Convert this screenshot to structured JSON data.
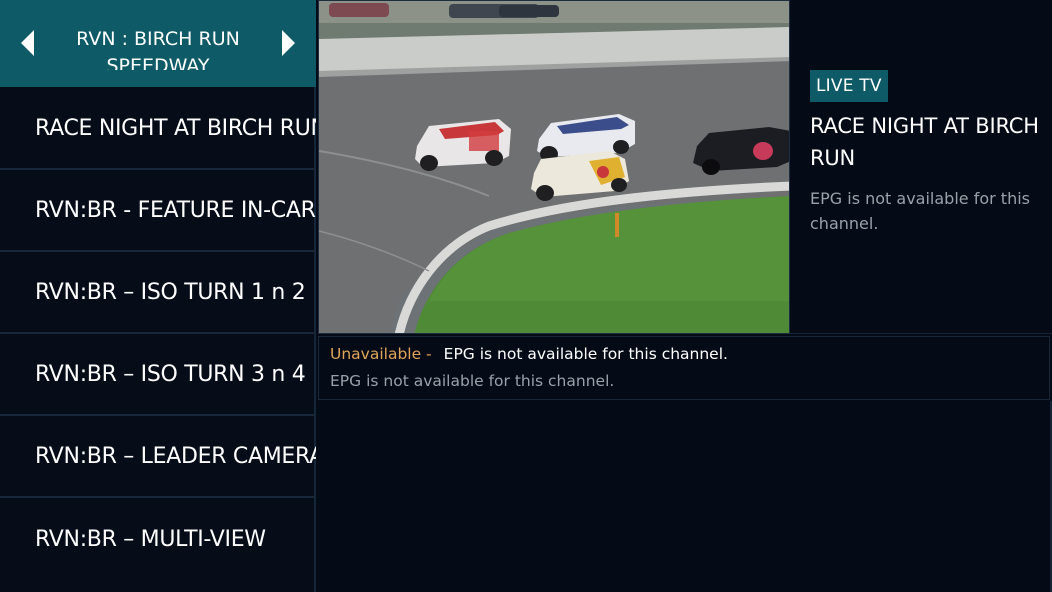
{
  "category": {
    "title": "RVN : BIRCH RUN SPEEDWAY"
  },
  "channels": [
    {
      "label": "RACE NIGHT AT BIRCH RUN"
    },
    {
      "label": "RVN:BR - FEATURE IN-CAR"
    },
    {
      "label": "RVN:BR – ISO TURN 1 n 2"
    },
    {
      "label": "RVN:BR – ISO TURN 3 n 4"
    },
    {
      "label": "RVN:BR – LEADER CAMERA"
    },
    {
      "label": "RVN:BR – MULTI-VIEW"
    }
  ],
  "info": {
    "badge": "LIVE TV",
    "title": "RACE NIGHT AT BIRCH RUN",
    "description": "EPG is not available for this channel."
  },
  "epg": {
    "status": "Unavailable -",
    "title": "EPG is not available for this channel.",
    "description": "EPG is not available for this channel."
  },
  "colors": {
    "accent": "#0e5a66",
    "background": "#050b16",
    "status_unavailable": "#e0a55a"
  },
  "icons": {
    "prev": "chevron-left-icon",
    "next": "chevron-right-icon"
  }
}
